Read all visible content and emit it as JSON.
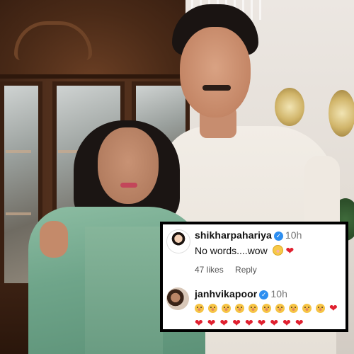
{
  "comments": [
    {
      "username": "shikharpahariya",
      "time": "10h",
      "text": "No words....wow",
      "emojis": [
        "flushed-face-emoji",
        "red-heart-emoji"
      ],
      "likes": "47 likes",
      "reply_label": "Reply"
    },
    {
      "username": "janhvikapoor",
      "time": "10h",
      "emoji_rows": [
        [
          "pleading-face",
          "pleading-face",
          "pleading-face",
          "pleading-face",
          "pleading-face",
          "pleading-face",
          "pleading-face",
          "pleading-face",
          "pleading-face",
          "pleading-face",
          "red-heart"
        ],
        [
          "red-heart",
          "red-heart",
          "red-heart",
          "red-heart",
          "red-heart",
          "red-heart",
          "red-heart",
          "red-heart",
          "red-heart"
        ]
      ]
    }
  ],
  "colors": {
    "verified": "#2d8ef0",
    "heart": "#e0202f",
    "card_border": "#000000"
  }
}
